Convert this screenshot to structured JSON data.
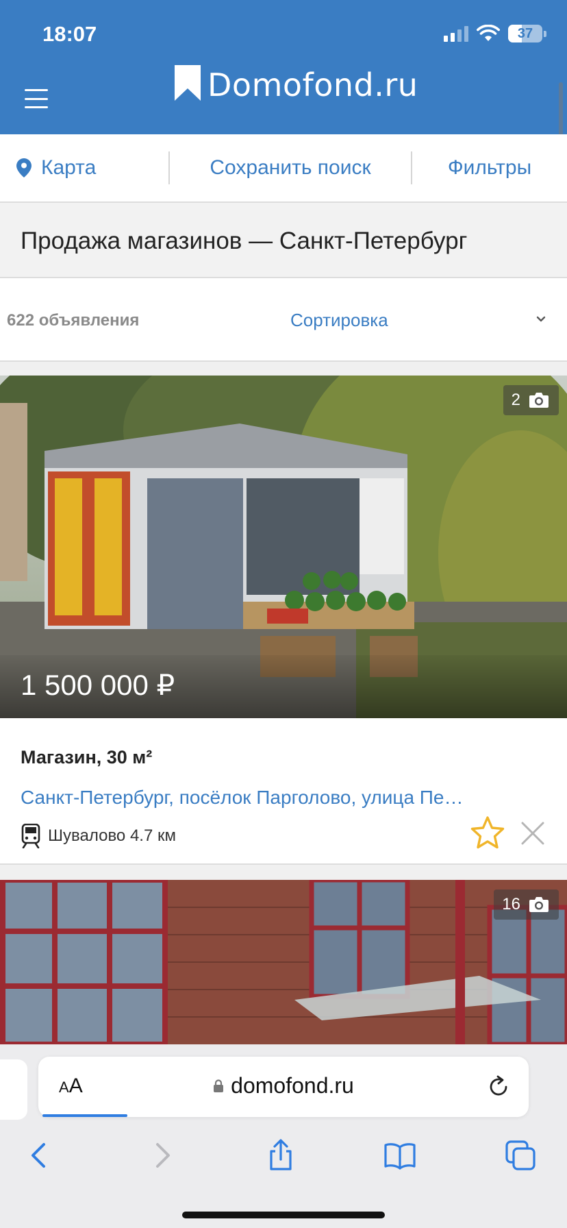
{
  "status_bar": {
    "time": "18:07",
    "battery": "37"
  },
  "header": {
    "logo_text": "Domofond.ru"
  },
  "actions": {
    "map": "Карта",
    "save_search": "Сохранить поиск",
    "filters": "Фильтры"
  },
  "page": {
    "title": "Продажа магазинов — Санкт-Петербург"
  },
  "results": {
    "count": "622 объявления",
    "sort": "Сортировка"
  },
  "listings": [
    {
      "photo_count": "2",
      "price": "1 500 000 ₽",
      "title": "Магазин, 30 м²",
      "address": "Санкт-Петербург, посёлок Парголово, улица Пе…",
      "metro": "Шувалово 4.7 км"
    },
    {
      "photo_count": "16"
    }
  ],
  "browser": {
    "aa": "AA",
    "url": "domofond.ru"
  },
  "colors": {
    "brand": "#3a7dc3",
    "star": "#f0b52a"
  },
  "icons": [
    "menu-icon",
    "map-pin-icon",
    "chevron-down-icon",
    "camera-icon",
    "train-icon",
    "star-icon",
    "close-icon",
    "lock-icon",
    "reload-icon",
    "back-icon",
    "forward-icon",
    "share-icon",
    "bookmarks-icon",
    "tabs-icon"
  ]
}
